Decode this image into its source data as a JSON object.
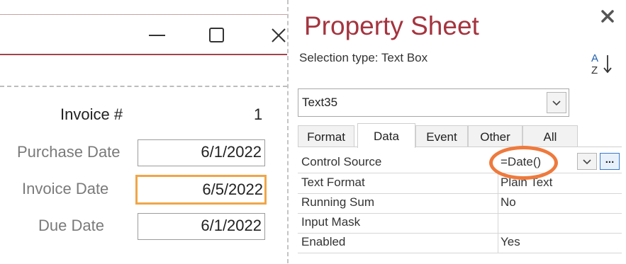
{
  "form": {
    "fields": [
      {
        "label": "Invoice #",
        "value": "1"
      },
      {
        "label": "Purchase Date",
        "value": "6/1/2022"
      },
      {
        "label": "Invoice Date",
        "value": "6/5/2022"
      },
      {
        "label": "Due Date",
        "value": "6/1/2022"
      }
    ],
    "focused_field_color": "#f0a648"
  },
  "property_sheet": {
    "title": "Property Sheet",
    "selection_type": "Selection type:  Text Box",
    "selected_object": "Text35",
    "tabs": [
      "Format",
      "Data",
      "Event",
      "Other",
      "All"
    ],
    "active_tab": "Data",
    "properties": [
      {
        "name": "Control Source",
        "value": "=Date()"
      },
      {
        "name": "Text Format",
        "value": "Plain Text"
      },
      {
        "name": "Running Sum",
        "value": "No"
      },
      {
        "name": "Input Mask",
        "value": ""
      },
      {
        "name": "Enabled",
        "value": "Yes"
      }
    ],
    "build_button_label": "...",
    "title_color": "#a4343f",
    "highlight_color": "#ee7a3d"
  },
  "icons": {
    "minimize": "minimize-icon",
    "maximize": "maximize-icon",
    "close": "close-icon",
    "sort": "sort-az-icon",
    "dropdown": "chevron-down-icon"
  }
}
